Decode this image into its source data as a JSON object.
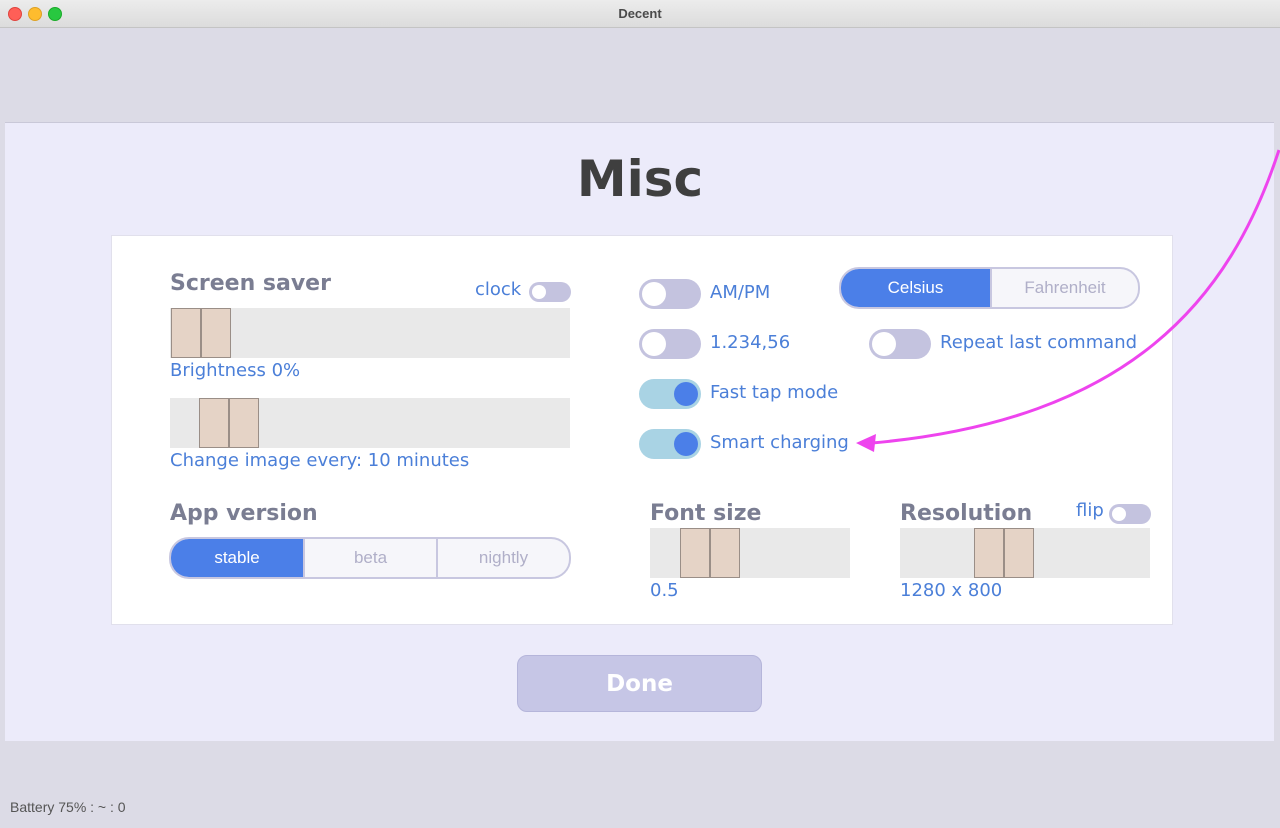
{
  "window": {
    "title": "Decent"
  },
  "page": {
    "title": "Misc"
  },
  "screen_saver": {
    "heading": "Screen saver",
    "clock_label": "clock",
    "brightness_label": "Brightness 0%",
    "brightness_value": 0,
    "change_image_label": "Change image every: 10 minutes"
  },
  "app_version": {
    "heading": "App version",
    "options": [
      "stable",
      "beta",
      "nightly"
    ],
    "selected": "stable"
  },
  "toggles": {
    "ampm": {
      "label": "AM/PM",
      "on": false
    },
    "number_format": {
      "label": "1.234,56",
      "on": false
    },
    "fast_tap": {
      "label": "Fast tap mode",
      "on": true
    },
    "smart_charging": {
      "label": "Smart charging",
      "on": true
    },
    "repeat_last": {
      "label": "Repeat last command",
      "on": false
    }
  },
  "temperature": {
    "options": [
      "Celsius",
      "Fahrenheit"
    ],
    "selected": "Celsius"
  },
  "font_size": {
    "heading": "Font size",
    "value": "0.5"
  },
  "resolution": {
    "heading": "Resolution",
    "flip_label": "flip",
    "value": "1280 x 800"
  },
  "done_button": {
    "label": "Done"
  },
  "status_bar": {
    "text": "Battery 75% : ~ : 0"
  },
  "colors": {
    "accent": "#4b7fe8",
    "annotation_arrow": "#ee44ee",
    "panel": "#ffffff",
    "dialog": "#ecebfa"
  }
}
